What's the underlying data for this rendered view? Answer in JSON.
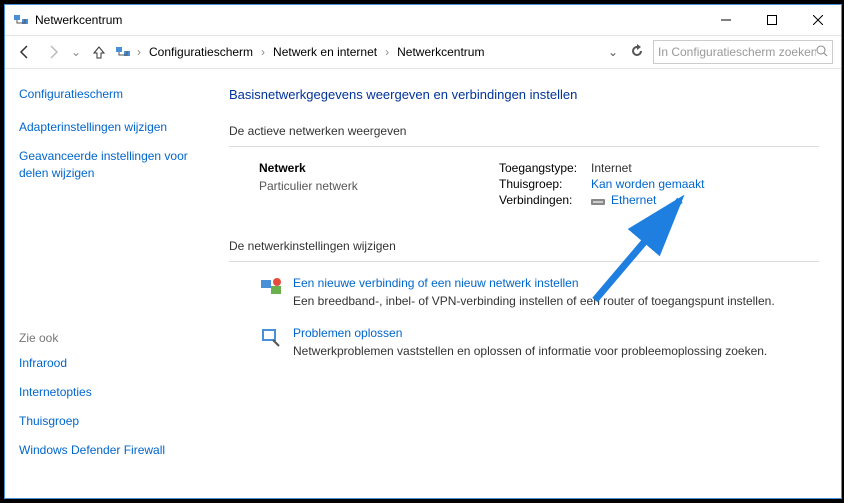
{
  "titlebar": {
    "title": "Netwerkcentrum"
  },
  "breadcrumbs": {
    "items": [
      "Configuratiescherm",
      "Netwerk en internet",
      "Netwerkcentrum"
    ]
  },
  "search": {
    "placeholder": "In Configuratiescherm zoeken"
  },
  "sidebar": {
    "cphead": "Configuratiescherm",
    "links": [
      "Adapterinstellingen wijzigen",
      "Geavanceerde instellingen voor delen wijzigen"
    ],
    "seealso_label": "Zie ook",
    "seealso": [
      "Infrarood",
      "Internetopties",
      "Thuisgroep",
      "Windows Defender Firewall"
    ]
  },
  "main": {
    "heading": "Basisnetwerkgegevens weergeven en verbindingen instellen",
    "active_section": "De actieve netwerken weergeven",
    "network": {
      "name": "Netwerk",
      "type": "Particulier netwerk",
      "rows": {
        "access_label": "Toegangstype:",
        "access_value": "Internet",
        "homegroup_label": "Thuisgroep:",
        "homegroup_value": "Kan worden gemaakt",
        "conn_label": "Verbindingen:",
        "conn_value": "Ethernet"
      }
    },
    "settings_section": "De netwerkinstellingen wijzigen",
    "actions": [
      {
        "title": "Een nieuwe verbinding of een nieuw netwerk instellen",
        "desc": "Een breedband-, inbel- of VPN-verbinding instellen of een router of toegangspunt instellen."
      },
      {
        "title": "Problemen oplossen",
        "desc": "Netwerkproblemen vaststellen en oplossen of informatie voor probleemoplossing zoeken."
      }
    ]
  }
}
